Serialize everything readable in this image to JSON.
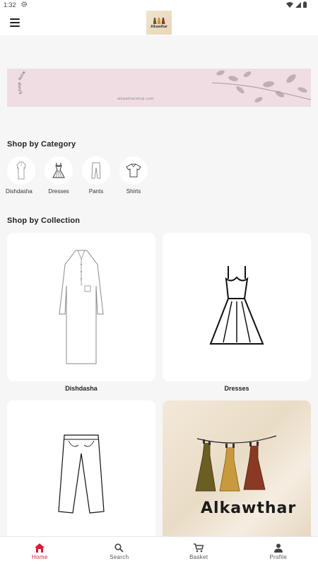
{
  "status_bar": {
    "time": "1:32"
  },
  "app_bar": {
    "logo_text": "Alkawthar"
  },
  "banner": {
    "stamp_text": "Shop Now · Shop Now ·",
    "url_text": "alkawtharshop.com"
  },
  "sections": {
    "category_title": "Shop by Category",
    "collection_title": "Shop by Collection"
  },
  "categories": [
    {
      "label": "Dishdasha"
    },
    {
      "label": "Dresses"
    },
    {
      "label": "Pants"
    },
    {
      "label": "Shirts"
    }
  ],
  "collections": [
    {
      "label": "Dishdasha"
    },
    {
      "label": "Dresses"
    },
    {
      "label": ""
    },
    {
      "label": "",
      "brand_text": "Alkawthar"
    }
  ],
  "bottom_nav": [
    {
      "label": "Home",
      "icon": "home-icon",
      "active": true
    },
    {
      "label": "Search",
      "icon": "search-icon",
      "active": false
    },
    {
      "label": "Basket",
      "icon": "cart-icon",
      "active": false
    },
    {
      "label": "Profile",
      "icon": "person-icon",
      "active": false
    }
  ],
  "colors": {
    "accent": "#e0173e",
    "banner_bg": "#efdde3",
    "background": "#f6f6f6"
  }
}
